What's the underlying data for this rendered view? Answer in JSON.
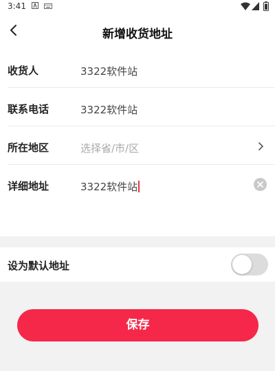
{
  "status_bar": {
    "time": "3:41"
  },
  "header": {
    "title": "新增收货地址"
  },
  "form": {
    "rows": [
      {
        "label": "收货人",
        "value": "3322软件站"
      },
      {
        "label": "联系电话",
        "value": "3322软件站"
      },
      {
        "label": "所在地区",
        "placeholder": "选择省/市/区"
      },
      {
        "label": "详细地址",
        "value": "3322软件站"
      }
    ]
  },
  "default_address": {
    "label": "设为默认地址",
    "enabled": false
  },
  "save_button": {
    "label": "保存"
  },
  "colors": {
    "accent": "#f5284a",
    "caret": "#e8333f",
    "placeholder": "#a8a8a8"
  },
  "icons": [
    "back-arrow-icon",
    "chevron-right-icon",
    "clear-icon",
    "wifi-icon",
    "signal-icon",
    "battery-icon"
  ]
}
